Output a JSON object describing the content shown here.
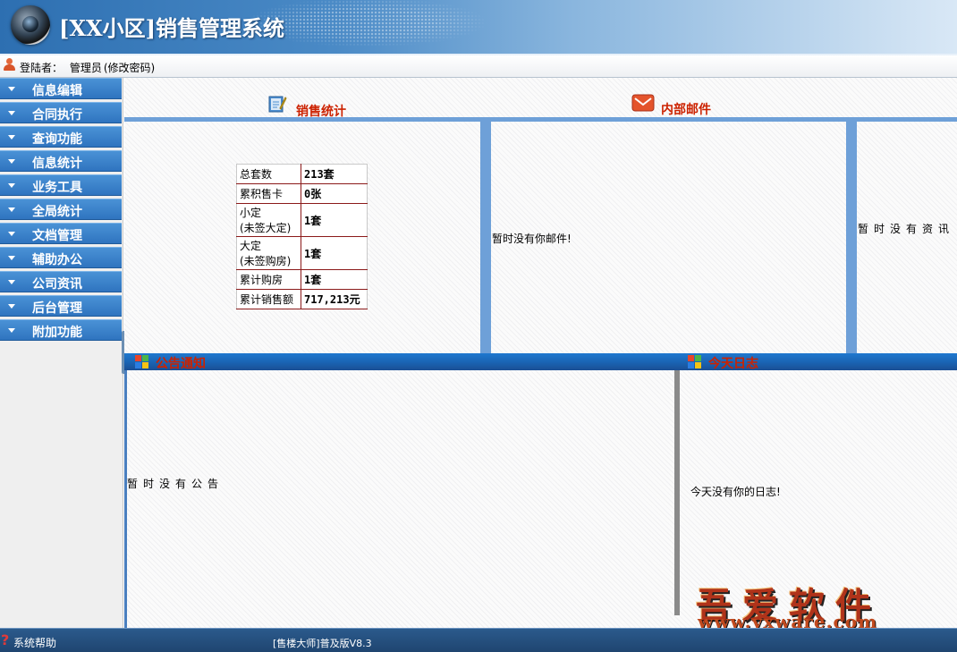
{
  "header": {
    "title": "[XX小区]销售管理系统"
  },
  "login_bar": {
    "label": "登陆者：",
    "user": "管理员",
    "change_password": "(修改密码)"
  },
  "sidebar": {
    "items": [
      {
        "label": "信息编辑"
      },
      {
        "label": "合同执行"
      },
      {
        "label": "查询功能"
      },
      {
        "label": "信息统计"
      },
      {
        "label": "业务工具"
      },
      {
        "label": "全局统计"
      },
      {
        "label": "文档管理"
      },
      {
        "label": "辅助办公"
      },
      {
        "label": "公司资讯"
      },
      {
        "label": "后台管理"
      },
      {
        "label": "附加功能"
      }
    ]
  },
  "sales_stats": {
    "title": "销售统计",
    "rows": [
      {
        "key": "总套数",
        "sub": "",
        "value": "213套"
      },
      {
        "key": "累积售卡",
        "sub": "",
        "value": "0张"
      },
      {
        "key": "小定",
        "sub": "(未签大定)",
        "value": "1套"
      },
      {
        "key": "大定",
        "sub": "(未签购房)",
        "value": "1套"
      },
      {
        "key": "累计购房",
        "sub": "",
        "value": "1套"
      },
      {
        "key": "累计销售额",
        "sub": "",
        "value": "717,213元"
      }
    ]
  },
  "mail": {
    "title": "内部邮件",
    "empty_message": "暂时没有你邮件!"
  },
  "news": {
    "empty_message": "暂时没有资讯"
  },
  "notice": {
    "title": "公告通知",
    "empty_message": "暂时没有公告"
  },
  "log": {
    "title": "今天日志",
    "empty_message": "今天没有你的日志!"
  },
  "watermark": {
    "cn": "吾爱软件",
    "url": "www.yxware.com"
  },
  "status_bar": {
    "help": "系统帮助",
    "version": "[售楼大师]普及版V8.3"
  },
  "colors": {
    "header_blue": "#2d6fb1",
    "menu_blue": "#2f74bf",
    "section_title_red": "#cc2200",
    "divider_blue": "#6ea0d8",
    "status_bar": "#1f4570"
  }
}
